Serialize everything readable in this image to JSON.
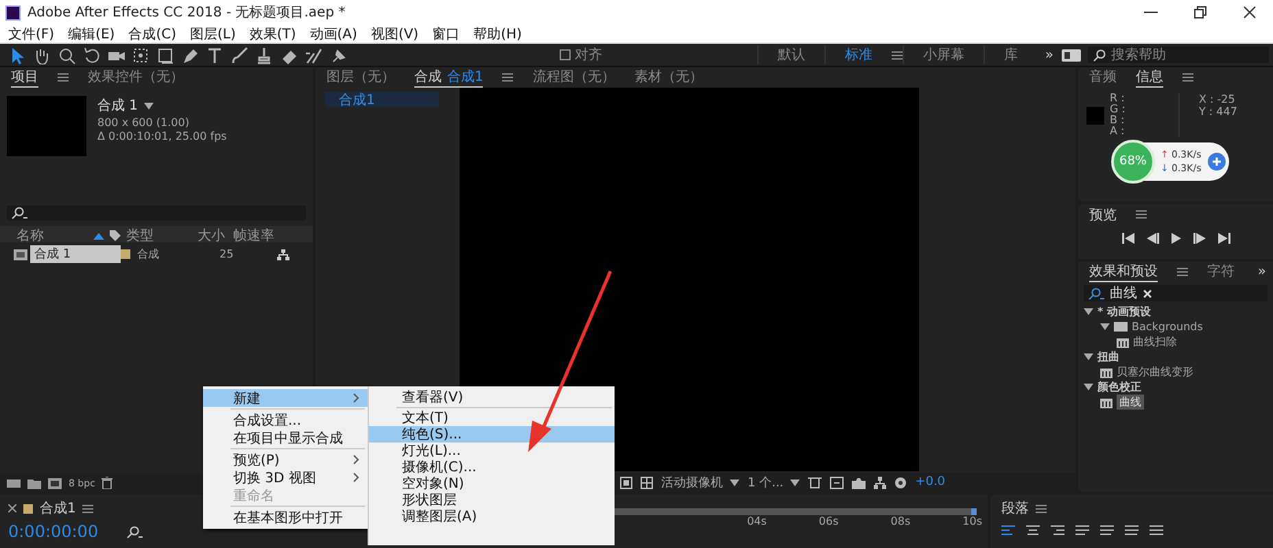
{
  "window": {
    "title": "Adobe After Effects CC 2018 - 无标题项目.aep *"
  },
  "menu_bar": [
    "文件(F)",
    "编辑(E)",
    "合成(C)",
    "图层(L)",
    "效果(T)",
    "动画(A)",
    "视图(V)",
    "窗口",
    "帮助(H)"
  ],
  "toolbar": {
    "snap": {
      "label": "对齐",
      "checked": false
    },
    "workspaces": [
      {
        "label": "默认",
        "selected": false
      },
      {
        "label": "标准",
        "selected": true
      },
      {
        "label": "小屏幕",
        "selected": false
      },
      {
        "label": "库",
        "selected": false
      }
    ],
    "more": "»",
    "search": {
      "placeholder": "搜索帮助"
    }
  },
  "project_panel": {
    "tabs": [
      {
        "label": "项目",
        "selected": true
      },
      {
        "label": "效果控件（无）",
        "selected": false
      }
    ],
    "comp": {
      "name": "合成 1",
      "size": "800 x 600 (1.00)",
      "duration": "Δ 0:00:10:01, 25.00 fps"
    },
    "columns": [
      "名称",
      "类型",
      "大小",
      "帧速率"
    ],
    "rows": [
      {
        "name": "合成 1",
        "type": "合成",
        "fps": "25",
        "selected": true
      }
    ],
    "footer": {
      "bpc": "8 bpc"
    }
  },
  "viewer": {
    "tabs": [
      {
        "label": "图层（无）",
        "selected": false
      },
      {
        "label": "合成",
        "chip": "合成1",
        "selected": true
      },
      {
        "label": "流程图（无）",
        "selected": false
      },
      {
        "label": "素材（无）",
        "selected": false
      }
    ],
    "breadcrumb": "合成1",
    "footer": {
      "camera": "活动摄像机",
      "views": "1 个...",
      "exposure": "+0.0"
    }
  },
  "info_panel": {
    "tabs": [
      {
        "label": "音频",
        "selected": false
      },
      {
        "label": "信息",
        "selected": true
      }
    ],
    "channels": [
      "R :",
      "G :",
      "B :",
      "A :"
    ],
    "x": "X : -25",
    "y": "Y : 447"
  },
  "net_widget": {
    "percent": "68%",
    "up_arrow": "↑",
    "up": "0.3K/s",
    "down_arrow": "↓",
    "down": "0.3K/s"
  },
  "preview_panel": {
    "title": "预览"
  },
  "effects_panel": {
    "tabs": [
      {
        "label": "效果和预设",
        "selected": true
      },
      {
        "label": "字符",
        "selected": false
      }
    ],
    "more": "»",
    "search": {
      "value": "曲线"
    },
    "tree": [
      {
        "label": "* 动画预设",
        "kind": "category",
        "expanded": true,
        "selected": false,
        "children": [
          {
            "label": "Backgrounds",
            "kind": "folder",
            "expanded": true,
            "selected": false,
            "children": [
              {
                "label": "曲线扫除",
                "kind": "preset",
                "selected": false
              }
            ]
          }
        ]
      },
      {
        "label": "扭曲",
        "kind": "category",
        "expanded": true,
        "selected": false,
        "children": [
          {
            "label": "贝塞尔曲线变形",
            "kind": "preset",
            "selected": false
          }
        ]
      },
      {
        "label": "颜色校正",
        "kind": "category",
        "expanded": true,
        "selected": false,
        "children": [
          {
            "label": "曲线",
            "kind": "preset",
            "selected": true
          }
        ]
      }
    ]
  },
  "timeline": {
    "tab": "合成1",
    "timecode": "0:00:00:00",
    "ruler": [
      "04s",
      "06s",
      "08s",
      "10s"
    ]
  },
  "paragraph_panel": {
    "title": "段落"
  },
  "context_menu": {
    "items": [
      {
        "kind": "item",
        "label": "新建",
        "selected": true,
        "disabled": false,
        "submenu": true
      },
      {
        "kind": "separator"
      },
      {
        "kind": "item",
        "label": "合成设置...",
        "selected": false,
        "disabled": false,
        "submenu": false
      },
      {
        "kind": "item",
        "label": "在项目中显示合成",
        "selected": false,
        "disabled": false,
        "submenu": false
      },
      {
        "kind": "separator"
      },
      {
        "kind": "item",
        "label": "预览(P)",
        "selected": false,
        "disabled": false,
        "submenu": true
      },
      {
        "kind": "item",
        "label": "切换 3D 视图",
        "selected": false,
        "disabled": false,
        "submenu": true
      },
      {
        "kind": "item",
        "label": "重命名",
        "selected": false,
        "disabled": true,
        "submenu": false
      },
      {
        "kind": "separator"
      },
      {
        "kind": "item",
        "label": "在基本图形中打开",
        "selected": false,
        "disabled": false,
        "submenu": false
      }
    ],
    "submenu": [
      {
        "kind": "item",
        "label": "查看器(V)",
        "selected": false
      },
      {
        "kind": "separator"
      },
      {
        "kind": "item",
        "label": "文本(T)",
        "selected": false
      },
      {
        "kind": "item",
        "label": "纯色(S)...",
        "selected": true
      },
      {
        "kind": "item",
        "label": "灯光(L)...",
        "selected": false
      },
      {
        "kind": "item",
        "label": "摄像机(C)...",
        "selected": false
      },
      {
        "kind": "item",
        "label": "空对象(N)",
        "selected": false
      },
      {
        "kind": "item",
        "label": "形状图层",
        "selected": false
      },
      {
        "kind": "item",
        "label": "调整图层(A)",
        "selected": false
      }
    ]
  }
}
